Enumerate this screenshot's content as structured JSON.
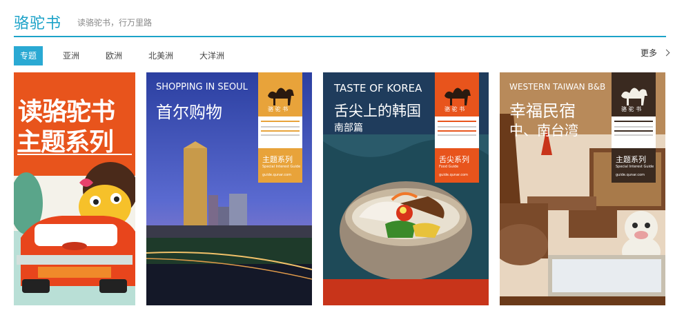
{
  "header": {
    "brand": "骆驼书",
    "slogan": "读骆驼书，行万里路"
  },
  "tabs": [
    {
      "label": "专题",
      "active": true
    },
    {
      "label": "亚洲",
      "active": false
    },
    {
      "label": "欧洲",
      "active": false
    },
    {
      "label": "北美洲",
      "active": false
    },
    {
      "label": "大洋洲",
      "active": false
    }
  ],
  "more": {
    "label": "更多"
  },
  "cards": [
    {
      "title_line1": "读骆驼书",
      "title_line2": "主题系列",
      "bg": "#e8541c"
    },
    {
      "en_title": "SHOPPING IN SEOUL",
      "cn_title": "首尔购物",
      "badge": "骆 驼 书",
      "series": "主题系列",
      "series_en": "Special Interest Guide",
      "site": "guide.qunar.com",
      "badge_color": "#e8a33a"
    },
    {
      "en_title": "TASTE OF KOREA",
      "cn_title": "舌尖上的韩国",
      "cn_sub": "南部篇",
      "badge": "骆 驼 书",
      "series": "舌尖系列",
      "series_en": "Food Guide",
      "site": "guide.qunar.com",
      "badge_color": "#e8541c"
    },
    {
      "en_title": "WESTERN TAIWAN B&B",
      "cn_title": "幸福民宿",
      "cn_sub": "中、南台湾",
      "badge": "骆 驼 书",
      "series": "主题系列",
      "series_en": "Special Interest Guide",
      "site": "guide.qunar.com",
      "badge_color": "#3a2a20"
    }
  ]
}
